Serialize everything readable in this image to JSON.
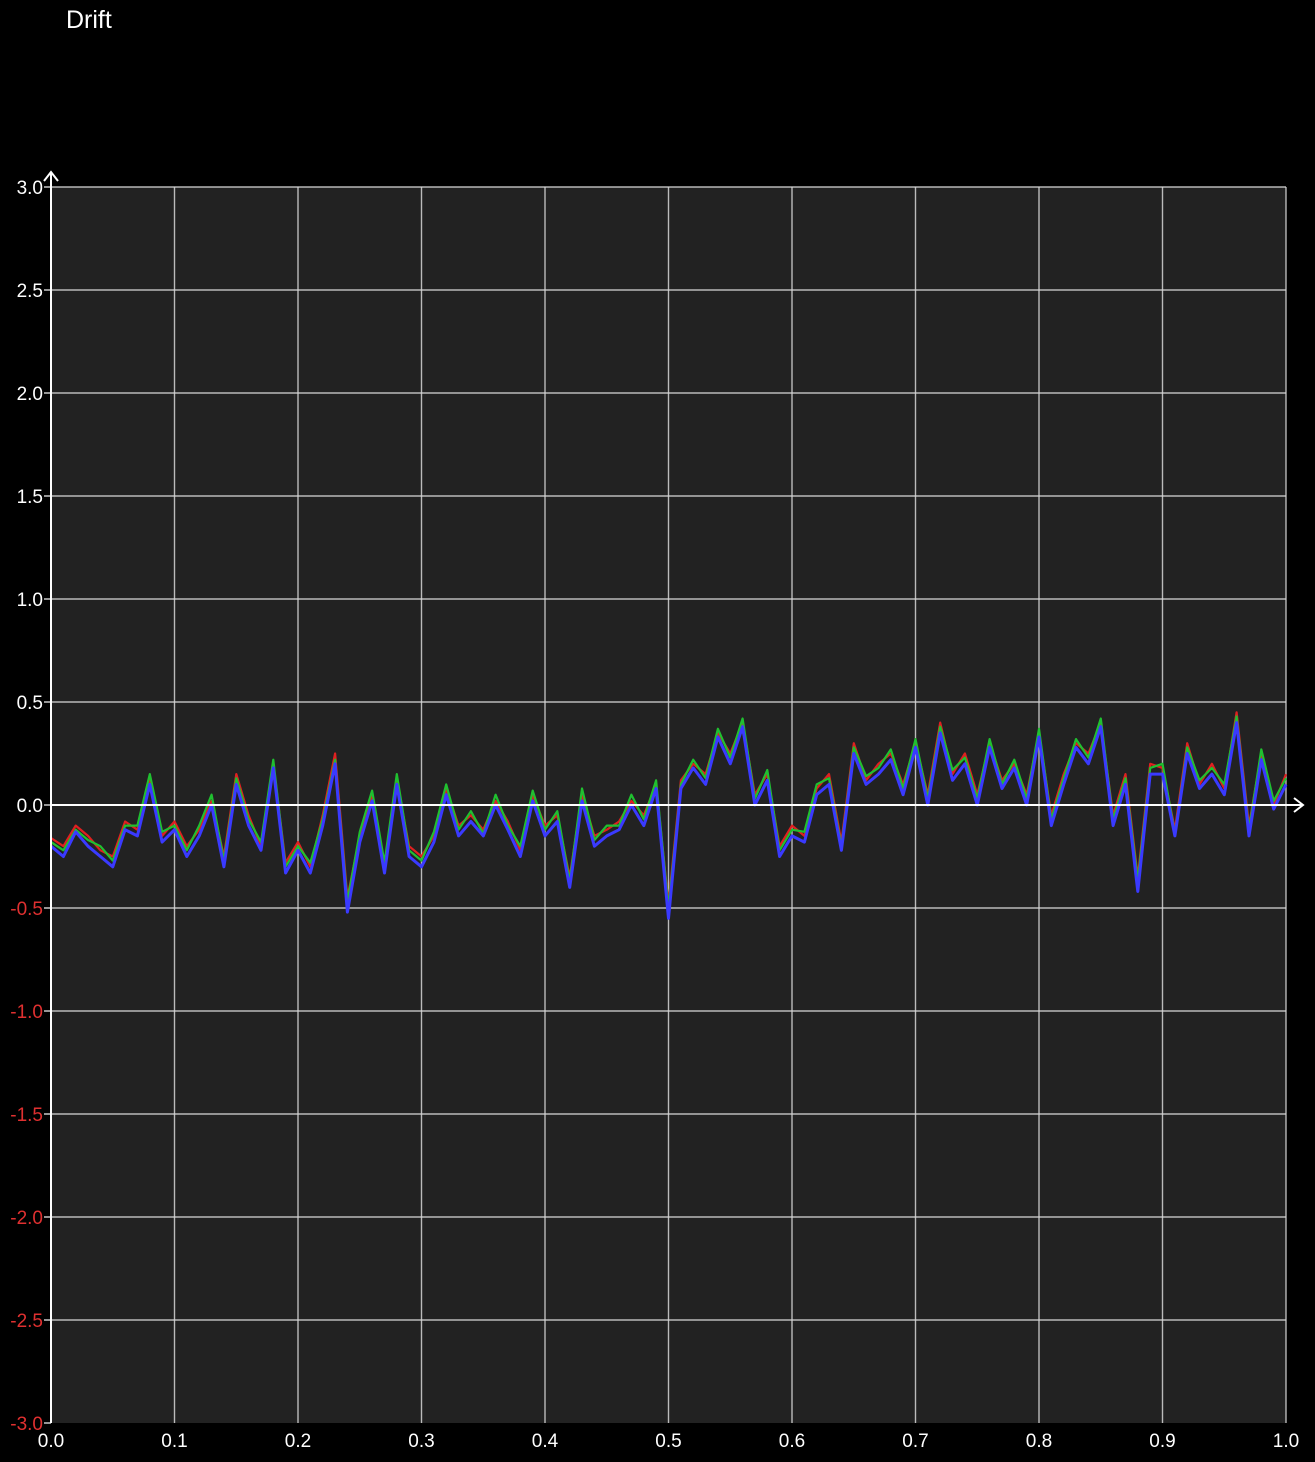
{
  "app": {
    "title": "Drift"
  },
  "colors": {
    "background": "#000000",
    "plot_area": "#222222",
    "grid": "#d6d6d6",
    "axis": "#ffffff",
    "tick_text_positive": "#ffffff",
    "tick_text_negative": "#e03030"
  },
  "chart_data": {
    "type": "line",
    "title": "Drift",
    "xlabel": "",
    "ylabel": "",
    "xlim": [
      0.0,
      1.0
    ],
    "ylim": [
      -3.0,
      3.0
    ],
    "grid": true,
    "legend": "none",
    "x_ticks": [
      "0.0",
      "0.1",
      "0.2",
      "0.3",
      "0.4",
      "0.5",
      "0.6",
      "0.7",
      "0.8",
      "0.9",
      "1.0"
    ],
    "y_ticks": [
      "3.0",
      "2.5",
      "2.0",
      "1.5",
      "1.0",
      "0.5",
      "0.0",
      "-0.5",
      "-1.0",
      "-1.5",
      "-2.0",
      "-2.5",
      "-3.0"
    ],
    "x": [
      0.0,
      0.01,
      0.02,
      0.03,
      0.04,
      0.05,
      0.06,
      0.07,
      0.08,
      0.09,
      0.1,
      0.11,
      0.12,
      0.13,
      0.14,
      0.15,
      0.16,
      0.17,
      0.18,
      0.19,
      0.2,
      0.21,
      0.22,
      0.23,
      0.24,
      0.25,
      0.26,
      0.27,
      0.28,
      0.29,
      0.3,
      0.31,
      0.32,
      0.33,
      0.34,
      0.35,
      0.36,
      0.37,
      0.38,
      0.39,
      0.4,
      0.41,
      0.42,
      0.43,
      0.44,
      0.45,
      0.46,
      0.47,
      0.48,
      0.49,
      0.5,
      0.51,
      0.52,
      0.53,
      0.54,
      0.55,
      0.56,
      0.57,
      0.58,
      0.59,
      0.6,
      0.61,
      0.62,
      0.63,
      0.64,
      0.65,
      0.66,
      0.67,
      0.68,
      0.69,
      0.7,
      0.71,
      0.72,
      0.73,
      0.74,
      0.75,
      0.76,
      0.77,
      0.78,
      0.79,
      0.8,
      0.81,
      0.82,
      0.83,
      0.84,
      0.85,
      0.86,
      0.87,
      0.88,
      0.89,
      0.9,
      0.91,
      0.92,
      0.93,
      0.94,
      0.95,
      0.96,
      0.97,
      0.98,
      0.99,
      1.0
    ],
    "series": [
      {
        "color": "#e02020",
        "values": [
          -0.16,
          -0.2,
          -0.1,
          -0.15,
          -0.22,
          -0.25,
          -0.08,
          -0.12,
          0.12,
          -0.15,
          -0.08,
          -0.2,
          -0.12,
          0.02,
          -0.25,
          0.15,
          -0.05,
          -0.2,
          0.2,
          -0.28,
          -0.18,
          -0.3,
          -0.05,
          0.25,
          -0.45,
          -0.15,
          0.05,
          -0.3,
          0.12,
          -0.2,
          -0.25,
          -0.15,
          0.08,
          -0.1,
          -0.05,
          -0.12,
          0.02,
          -0.08,
          -0.22,
          0.05,
          -0.1,
          -0.05,
          -0.35,
          0.05,
          -0.15,
          -0.12,
          -0.08,
          0.02,
          -0.05,
          0.1,
          -0.48,
          0.12,
          0.2,
          0.15,
          0.35,
          0.25,
          0.4,
          0.05,
          0.15,
          -0.2,
          -0.1,
          -0.15,
          0.08,
          0.15,
          -0.18,
          0.3,
          0.12,
          0.2,
          0.25,
          0.1,
          0.3,
          0.05,
          0.4,
          0.15,
          0.25,
          0.05,
          0.3,
          0.12,
          0.2,
          0.05,
          0.35,
          -0.05,
          0.15,
          0.3,
          0.25,
          0.4,
          -0.05,
          0.15,
          -0.35,
          0.2,
          0.18,
          -0.12,
          0.3,
          0.1,
          0.2,
          0.08,
          0.45,
          -0.1,
          0.25,
          0.0,
          0.15
        ]
      },
      {
        "color": "#20c030",
        "values": [
          -0.18,
          -0.22,
          -0.12,
          -0.17,
          -0.2,
          -0.27,
          -0.1,
          -0.1,
          0.15,
          -0.13,
          -0.1,
          -0.22,
          -0.1,
          0.05,
          -0.27,
          0.13,
          -0.07,
          -0.18,
          0.22,
          -0.3,
          -0.2,
          -0.28,
          -0.07,
          0.22,
          -0.47,
          -0.13,
          0.07,
          -0.28,
          0.15,
          -0.22,
          -0.27,
          -0.13,
          0.1,
          -0.12,
          -0.03,
          -0.14,
          0.05,
          -0.1,
          -0.2,
          0.07,
          -0.12,
          -0.03,
          -0.37,
          0.08,
          -0.17,
          -0.1,
          -0.1,
          0.05,
          -0.07,
          0.12,
          -0.5,
          0.1,
          0.22,
          0.13,
          0.37,
          0.23,
          0.42,
          0.03,
          0.17,
          -0.22,
          -0.12,
          -0.13,
          0.1,
          0.13,
          -0.2,
          0.28,
          0.14,
          0.18,
          0.27,
          0.08,
          0.32,
          0.03,
          0.38,
          0.17,
          0.23,
          0.03,
          0.32,
          0.1,
          0.22,
          0.03,
          0.37,
          -0.07,
          0.13,
          0.32,
          0.23,
          0.42,
          -0.07,
          0.13,
          -0.37,
          0.18,
          0.2,
          -0.14,
          0.28,
          0.12,
          0.18,
          0.1,
          0.43,
          -0.12,
          0.27,
          0.02,
          0.13
        ]
      },
      {
        "color": "#3a3aff",
        "values": [
          -0.2,
          -0.25,
          -0.13,
          -0.2,
          -0.25,
          -0.3,
          -0.12,
          -0.15,
          0.1,
          -0.18,
          -0.12,
          -0.25,
          -0.15,
          0.0,
          -0.3,
          0.1,
          -0.1,
          -0.22,
          0.18,
          -0.33,
          -0.22,
          -0.33,
          -0.1,
          0.2,
          -0.52,
          -0.18,
          0.02,
          -0.33,
          0.1,
          -0.25,
          -0.3,
          -0.18,
          0.05,
          -0.15,
          -0.08,
          -0.15,
          0.0,
          -0.12,
          -0.25,
          0.02,
          -0.15,
          -0.08,
          -0.4,
          0.02,
          -0.2,
          -0.15,
          -0.12,
          0.0,
          -0.1,
          0.08,
          -0.55,
          0.08,
          0.18,
          0.1,
          0.33,
          0.2,
          0.38,
          0.0,
          0.12,
          -0.25,
          -0.15,
          -0.18,
          0.05,
          0.1,
          -0.22,
          0.25,
          0.1,
          0.15,
          0.22,
          0.05,
          0.28,
          0.0,
          0.35,
          0.12,
          0.2,
          0.0,
          0.28,
          0.08,
          0.18,
          0.0,
          0.33,
          -0.1,
          0.1,
          0.28,
          0.2,
          0.38,
          -0.1,
          0.1,
          -0.42,
          0.15,
          0.15,
          -0.15,
          0.25,
          0.08,
          0.15,
          0.05,
          0.4,
          -0.15,
          0.22,
          -0.02,
          0.1
        ]
      }
    ]
  }
}
